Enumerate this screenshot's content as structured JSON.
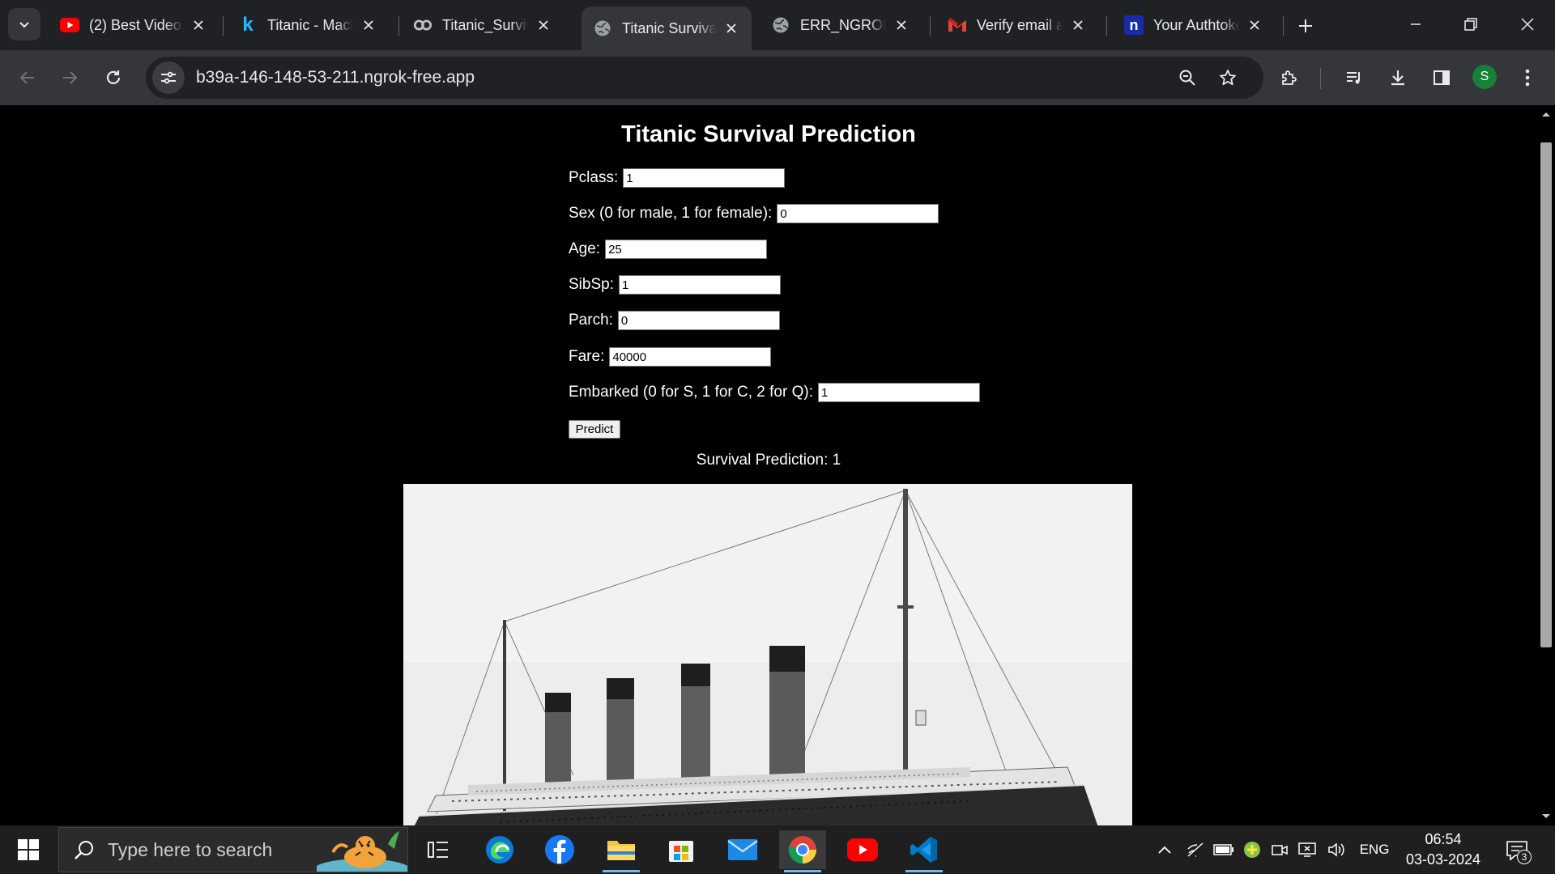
{
  "browser": {
    "tabs": [
      {
        "title": "(2) Best Video",
        "favicon": "youtube-icon",
        "active": false
      },
      {
        "title": "Titanic - Mach",
        "favicon": "kaggle-icon",
        "active": false
      },
      {
        "title": "Titanic_Surviv",
        "favicon": "colab-icon",
        "active": false
      },
      {
        "title": "Titanic Surviva",
        "favicon": "globe-icon",
        "active": true
      },
      {
        "title": "ERR_NGROK_6",
        "favicon": "globe-icon",
        "active": false
      },
      {
        "title": "Verify email ad",
        "favicon": "gmail-icon",
        "active": false
      },
      {
        "title": "Your Authtoke",
        "favicon": "ngrok-icon",
        "active": false
      }
    ],
    "url": "b39a-146-148-53-211.ngrok-free.app",
    "profile_initial": "S"
  },
  "page": {
    "title": "Titanic Survival Prediction",
    "fields": [
      {
        "label": "Pclass:",
        "value": "1"
      },
      {
        "label": "Sex (0 for male, 1 for female):",
        "value": "0"
      },
      {
        "label": "Age:",
        "value": "25"
      },
      {
        "label": "SibSp:",
        "value": "1"
      },
      {
        "label": "Parch:",
        "value": "0"
      },
      {
        "label": "Fare:",
        "value": "40000"
      },
      {
        "label": "Embarked (0 for S, 1 for C, 2 for Q):",
        "value": "1"
      }
    ],
    "predict_label": "Predict",
    "result_text": "Survival Prediction: 1"
  },
  "taskbar": {
    "search_placeholder": "Type here to search",
    "language": "ENG",
    "time": "06:54",
    "date": "03-03-2024",
    "notification_count": "3"
  }
}
